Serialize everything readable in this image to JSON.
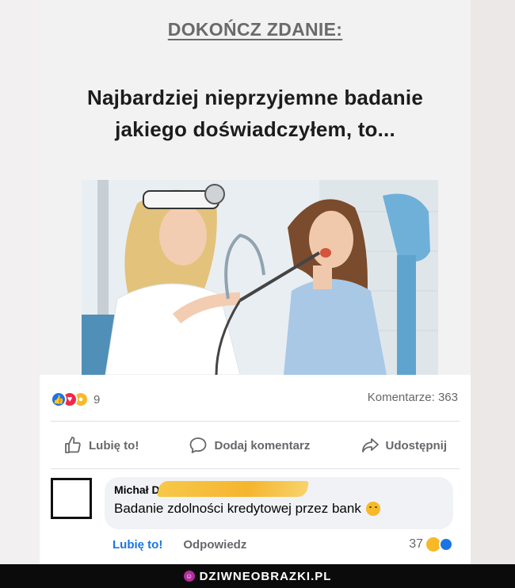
{
  "meme": {
    "heading": "DOKOŃCZ ZDANIE:",
    "question_line1": "Najbardziej nieprzyjemne badanie",
    "question_line2": "jakiego doświadczyłem, to..."
  },
  "post": {
    "reaction_icons": [
      "like-icon",
      "love-icon",
      "sad-icon"
    ],
    "reaction_count": "9",
    "comments_count": "Komentarze: 363",
    "actions": {
      "like": "Lubię to!",
      "comment": "Dodaj komentarz",
      "share": "Udostępnij"
    }
  },
  "comment": {
    "author_visible": "Michał D",
    "text": "Badanie zdolności kredytowej przez bank",
    "like_label": "Lubię to!",
    "reply_label": "Odpowiedz",
    "reaction_count": "37",
    "reaction_icons": [
      "haha-icon",
      "like-icon"
    ]
  },
  "footer": {
    "brand": "DZIWNEOBRAZKI.PL"
  },
  "colors": {
    "facebook_blue": "#1b74e4",
    "love_red": "#f02849",
    "reaction_yellow": "#f7b928",
    "muted_text": "#65676b",
    "censor_highlight": "#f5b52e"
  }
}
